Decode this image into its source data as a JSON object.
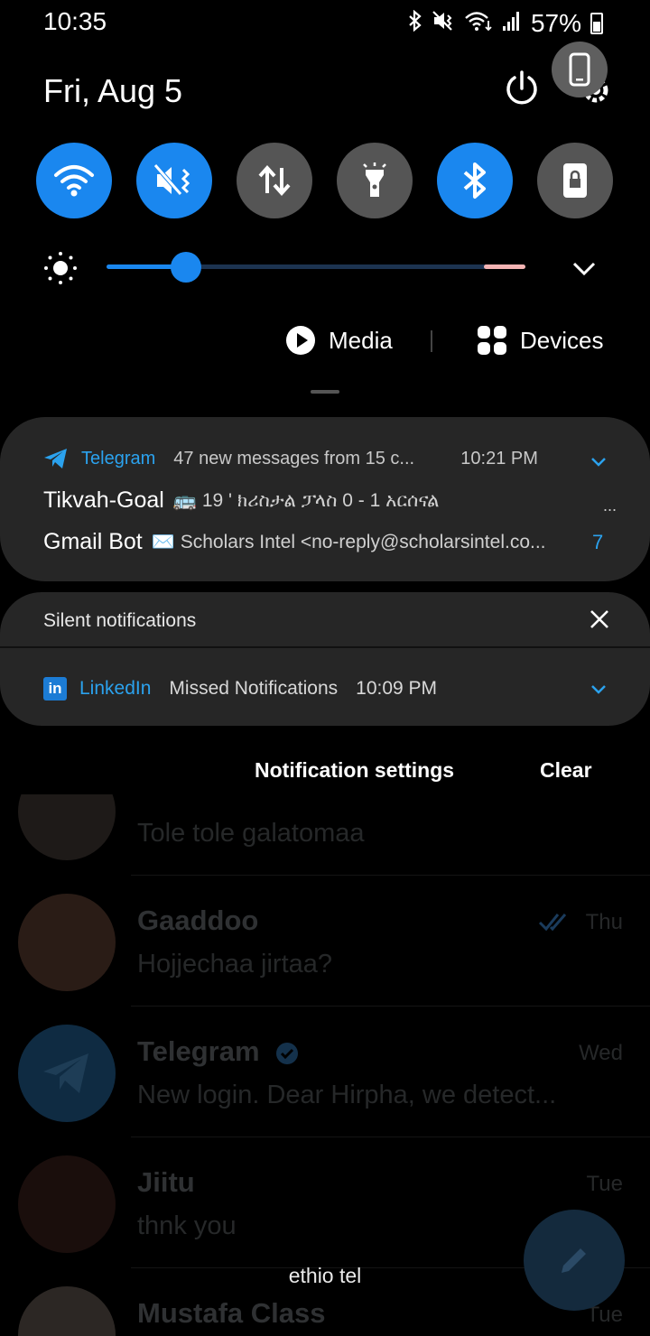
{
  "status_bar": {
    "time": "10:35",
    "battery": "57%"
  },
  "date": "Fri, Aug 5",
  "colors": {
    "accent": "#1a87ef",
    "telegram": "#2ba2ee",
    "toggle_off": "#555555",
    "card": "#262626"
  },
  "quick_toggles": [
    {
      "name": "wifi-icon",
      "state": "on"
    },
    {
      "name": "mute-vibrate-icon",
      "state": "on"
    },
    {
      "name": "mobile-data-icon",
      "state": "off"
    },
    {
      "name": "flashlight-icon",
      "state": "off"
    },
    {
      "name": "bluetooth-icon",
      "state": "on"
    },
    {
      "name": "screen-lock-icon",
      "state": "off"
    }
  ],
  "brightness": {
    "level": 0.19
  },
  "media_label": "Media",
  "devices_label": "Devices",
  "telegram_notification": {
    "app": "Telegram",
    "summary": "47 new messages from 15 c...",
    "time": "10:21 PM",
    "messages": [
      {
        "sender": "Tikvah-Goal",
        "text": "🚌 19 ' ክሪስታል ፓላስ 0 - 1 አርሰናል"
      },
      {
        "sender": "Gmail Bot",
        "text": "✉️ Scholars Intel <no-reply@scholarsintel.co..."
      }
    ],
    "more": "...",
    "count": "7"
  },
  "silent": {
    "title": "Silent notifications",
    "app": "LinkedIn",
    "text": "Missed Notifications",
    "time": "10:09 PM"
  },
  "actions": {
    "settings": "Notification settings",
    "clear": "Clear"
  },
  "chats": [
    {
      "name": "",
      "preview": "Tole tole galatomaa",
      "date": ""
    },
    {
      "name": "Gaaddoo",
      "preview": "Hojjechaa jirtaa?",
      "date": "Thu"
    },
    {
      "name": "Telegram",
      "preview": "New login. Dear Hirpha, we detect...",
      "date": "Wed"
    },
    {
      "name": "Jiitu",
      "preview": "thnk you",
      "date": "Tue"
    },
    {
      "name": "Mustafa Class",
      "preview": "",
      "date": "Tue"
    }
  ],
  "carrier": "ethio tel"
}
